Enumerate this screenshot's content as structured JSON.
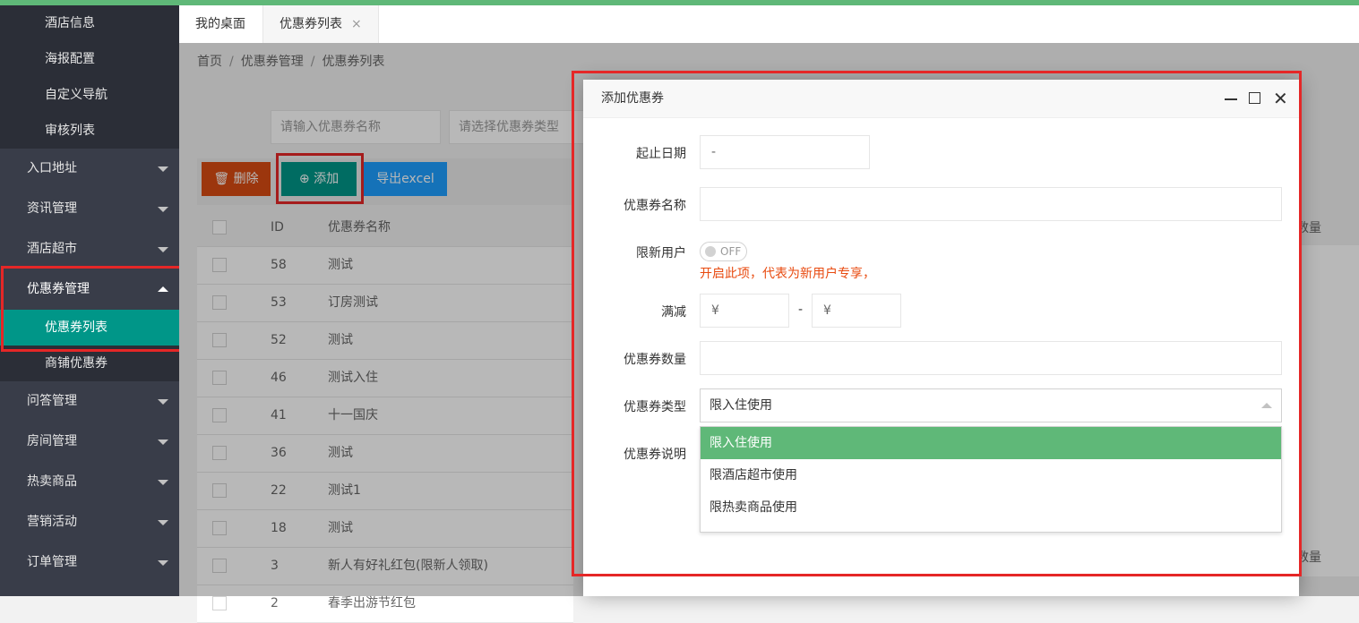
{
  "sidebar": {
    "top_subitems": [
      "酒店信息",
      "海报配置",
      "自定义导航",
      "审核列表"
    ],
    "groups_before": [
      "入口地址",
      "资讯管理",
      "酒店超市"
    ],
    "open_group": "优惠券管理",
    "open_subitems": [
      "优惠券列表",
      "商铺优惠券"
    ],
    "groups_after": [
      "问答管理",
      "房间管理",
      "热卖商品",
      "营销活动",
      "订单管理"
    ]
  },
  "tabs": [
    {
      "label": "我的桌面"
    },
    {
      "label": "优惠券列表",
      "close": "×"
    }
  ],
  "breadcrumb": [
    "首页",
    "优惠券管理",
    "优惠券列表"
  ],
  "breadcrumb_sep": "/",
  "search": {
    "name_placeholder": "请输入优惠券名称",
    "type_placeholder": "请选择优惠券类型"
  },
  "toolbar": {
    "delete_label": "删除",
    "add_label": "添加",
    "export_label": "导出excel"
  },
  "table": {
    "headers": [
      "ID",
      "优惠券名称"
    ],
    "right_header_fragment": "数量",
    "rows": [
      {
        "id": "58",
        "name": "测试"
      },
      {
        "id": "53",
        "name": "订房测试"
      },
      {
        "id": "52",
        "name": "测试"
      },
      {
        "id": "46",
        "name": "测试入住"
      },
      {
        "id": "41",
        "name": "十一国庆"
      },
      {
        "id": "36",
        "name": "测试"
      },
      {
        "id": "22",
        "name": "测试1"
      },
      {
        "id": "18",
        "name": "测试"
      },
      {
        "id": "3",
        "name": "新人有好礼红包(限新人领取)"
      },
      {
        "id": "2",
        "name": "春季出游节红包"
      }
    ]
  },
  "modal": {
    "title": "添加优惠券",
    "fields": {
      "date_label": "起止日期",
      "date_value": "-",
      "name_label": "优惠券名称",
      "new_user_label": "限新用户",
      "switch_text": "OFF",
      "new_user_hint": "开启此项，代表为新用户专享，",
      "discount_label": "满减",
      "currency": "¥",
      "range_sep": "-",
      "quantity_label": "优惠券数量",
      "type_label": "优惠券类型",
      "type_value": "限入住使用",
      "desc_label": "优惠券说明"
    },
    "type_options": [
      "限入住使用",
      "限酒店超市使用",
      "限热卖商品使用"
    ],
    "selected_option": 0
  },
  "colors": {
    "accent": "#009688",
    "green_bar": "#5fb878",
    "danger": "#d84b12",
    "info": "#1e9fff",
    "annotation": "#e52727"
  }
}
